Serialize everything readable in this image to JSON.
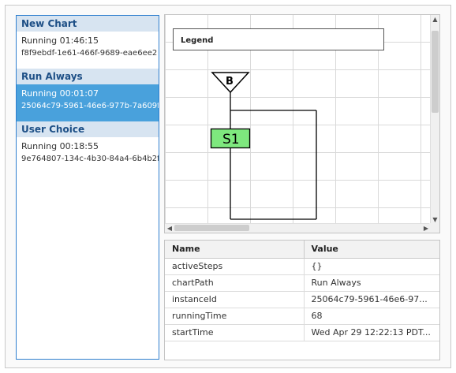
{
  "chart_list": {
    "groups": [
      {
        "name": "New Chart",
        "instances": [
          {
            "status": "Running 01:46:15",
            "id": "f8f9ebdf-1e61-466f-9689-eae6ee2",
            "selected": false
          }
        ]
      },
      {
        "name": "Run Always",
        "instances": [
          {
            "status": "Running 00:01:07",
            "id": "25064c79-5961-46e6-977b-7a609f",
            "selected": true
          }
        ]
      },
      {
        "name": "User Choice",
        "instances": [
          {
            "status": "Running 00:18:55",
            "id": "9e764807-134c-4b30-84a4-6b4b2f",
            "selected": false
          }
        ]
      }
    ]
  },
  "chart_view": {
    "legend_label": "Legend",
    "begin_label": "B",
    "step_label": "S1",
    "colors": {
      "step_fill": "#7ee87e",
      "grid": "#d9d9d9"
    }
  },
  "properties": {
    "headers": {
      "name": "Name",
      "value": "Value"
    },
    "rows": [
      {
        "name": "activeSteps",
        "value": "{}"
      },
      {
        "name": "chartPath",
        "value": "Run Always"
      },
      {
        "name": "instanceId",
        "value": "25064c79-5961-46e6-97..."
      },
      {
        "name": "runningTime",
        "value": "68"
      },
      {
        "name": "startTime",
        "value": "Wed Apr 29 12:22:13 PDT..."
      }
    ]
  },
  "colors": {
    "accent": "#2f7fcf",
    "selected_bg": "#49a1dc",
    "group_header_bg": "#d7e4f1"
  }
}
